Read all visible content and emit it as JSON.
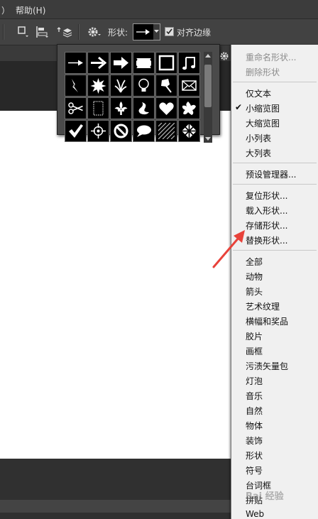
{
  "menubar": {
    "item_partial": "）",
    "help": "帮助(H)"
  },
  "options_bar": {
    "shape_label": "形状:",
    "align_edges_label": "对齐边缘",
    "align_edges_checked": true
  },
  "shape_picker": {
    "shapes": [
      "thin-arrow-icon",
      "bold-arrow-icon",
      "block-arrow-icon",
      "banner-icon",
      "frame-icon",
      "music-note-icon",
      "lightning-icon",
      "starburst-icon",
      "grass-icon",
      "lightbulb-icon",
      "pushpin-icon",
      "envelope-icon",
      "scissors-icon",
      "dotted-frame-icon",
      "fleur-de-lis-icon",
      "ornament-icon",
      "heart-icon",
      "splat-icon",
      "checkmark-icon",
      "target-icon",
      "no-sign-icon",
      "speech-bubble-icon",
      "diagonal-pattern-icon",
      "checker-pattern-icon"
    ]
  },
  "context_menu": {
    "rename_shape": "重命名形状...",
    "delete_shape": "删除形状",
    "text_only": "仅文本",
    "small_thumbnail": "小缩览图",
    "small_thumbnail_checked": true,
    "large_thumbnail": "大缩览图",
    "small_list": "小列表",
    "large_list": "大列表",
    "preset_manager": "预设管理器...",
    "reset_shapes": "复位形状...",
    "load_shapes": "载入形状...",
    "save_shapes": "存储形状...",
    "replace_shapes": "替换形状...",
    "libraries": [
      "全部",
      "动物",
      "箭头",
      "艺术纹理",
      "横幅和奖品",
      "胶片",
      "画框",
      "污渍矢量包",
      "灯泡",
      "音乐",
      "自然",
      "物体",
      "装饰",
      "形状",
      "符号",
      "台词框",
      "拼贴",
      "Web"
    ],
    "check_mark": "✔"
  },
  "watermark": "Bai 经验",
  "colors": {
    "accent_arrow": "#e8423a",
    "menu_bg": "#f0f0f0",
    "dark_bg": "#535353"
  }
}
